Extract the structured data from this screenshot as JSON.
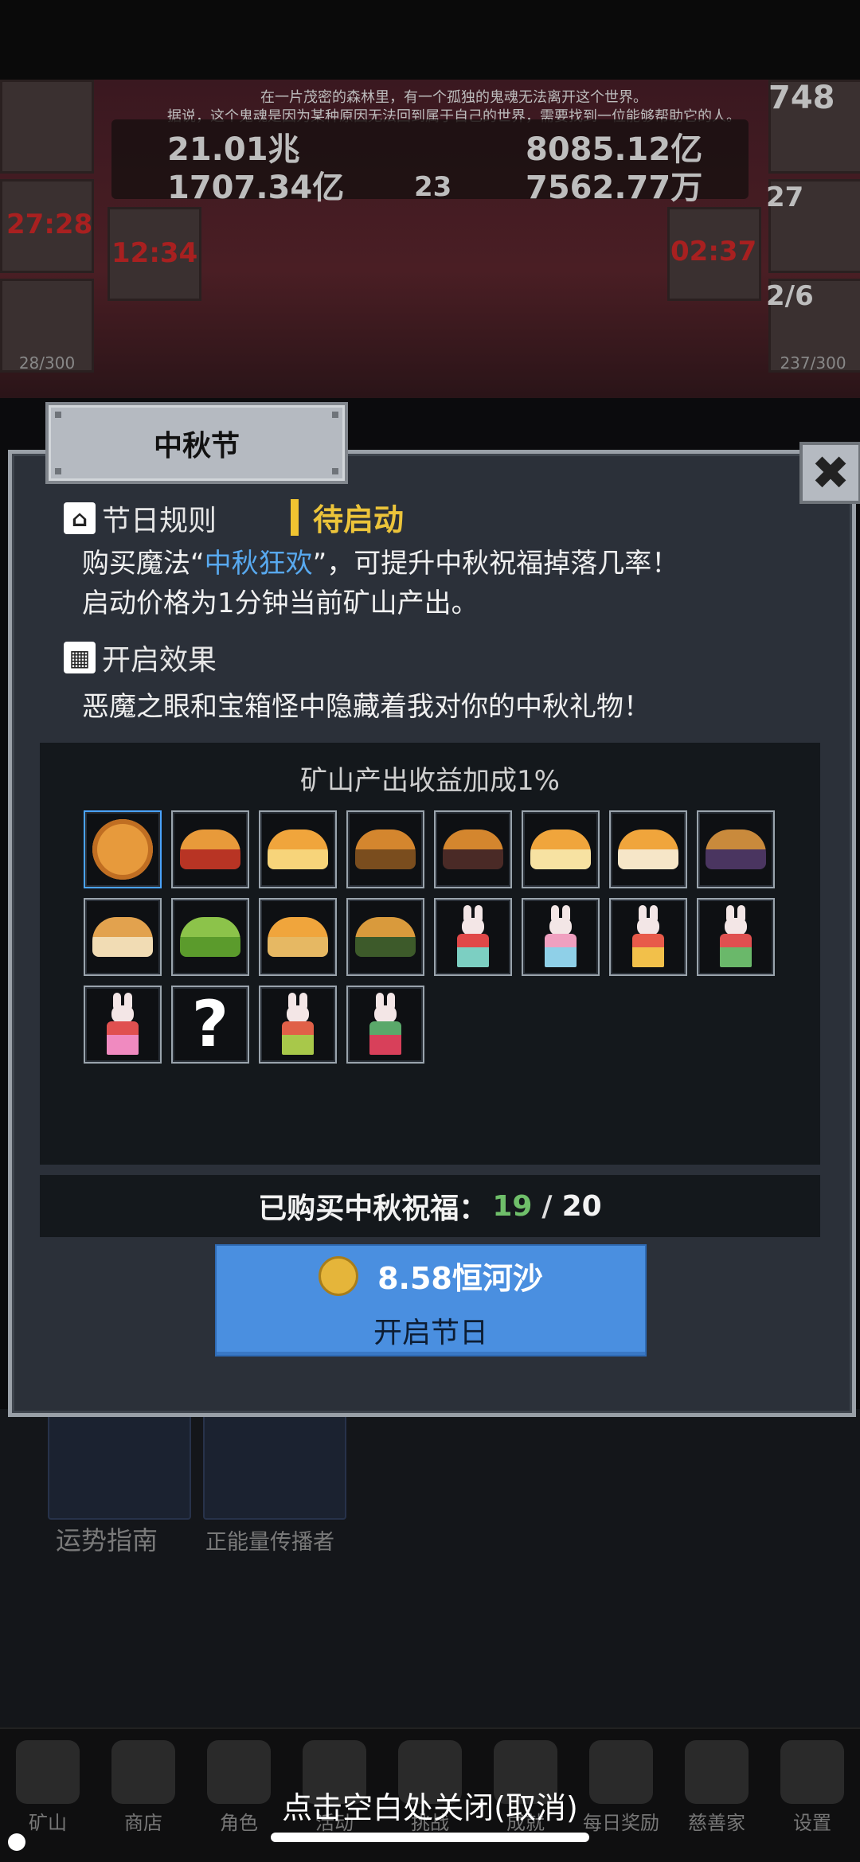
{
  "background": {
    "story_line1": "在一片茂密的森林里，有一个孤独的鬼魂无法离开这个世界。",
    "story_line2": "据说，这个鬼魂是因为某种原因无法回到属于自己的世界，需要找到一位能够帮助它的人。",
    "res1": "21.01兆",
    "res2": "1707.34亿",
    "res3": "8085.12亿",
    "res4": "7562.77万",
    "book_count": "23",
    "right_top_count": "748",
    "chest_count": "27",
    "timer_left": "27:28",
    "timer_mid": "12:34",
    "timer_right": "02:37",
    "slime_count": "2/6",
    "left_capacity": "28/300",
    "right_capacity": "237/300",
    "card1_label": "运势指南",
    "card2_label": "正能量传播者"
  },
  "nav": {
    "items": [
      "矿山",
      "商店",
      "角色",
      "活动",
      "挑战",
      "成就",
      "每日奖励",
      "慈善家",
      "设置"
    ]
  },
  "close_hint": "点击空白处关闭(取消)",
  "dialog": {
    "title": "中秋节",
    "close_symbol": "✖",
    "rules_heading": "节日规则",
    "status": "待启动",
    "rule_text_pre": "购买魔法“",
    "rule_highlight": "中秋狂欢",
    "rule_text_post": "”，可提升中秋祝福掉落几率！",
    "rule_text_line2": "启动价格为1分钟当前矿山产出。",
    "effect_heading": "开启效果",
    "effect_text": "恶魔之眼和宝箱怪中隐藏着我对你的中秋礼物！",
    "grid_title": "矿山产出收益加成1%",
    "purchased_label": "已购买中秋祝福：",
    "purchased_current": "19",
    "purchased_total": "20",
    "price": "8.58恒河沙",
    "start_label": "开启节日"
  },
  "colors": {
    "highlight_blue": "#58a9ef",
    "status_yellow": "#ecc43a",
    "count_green": "#6fbf6a",
    "button_blue": "#4a8fe0"
  },
  "icons": {
    "rules": "home-icon",
    "effect": "grid-icon",
    "status": "exclamation-icon",
    "price": "coin-icon",
    "close": "close-icon"
  }
}
